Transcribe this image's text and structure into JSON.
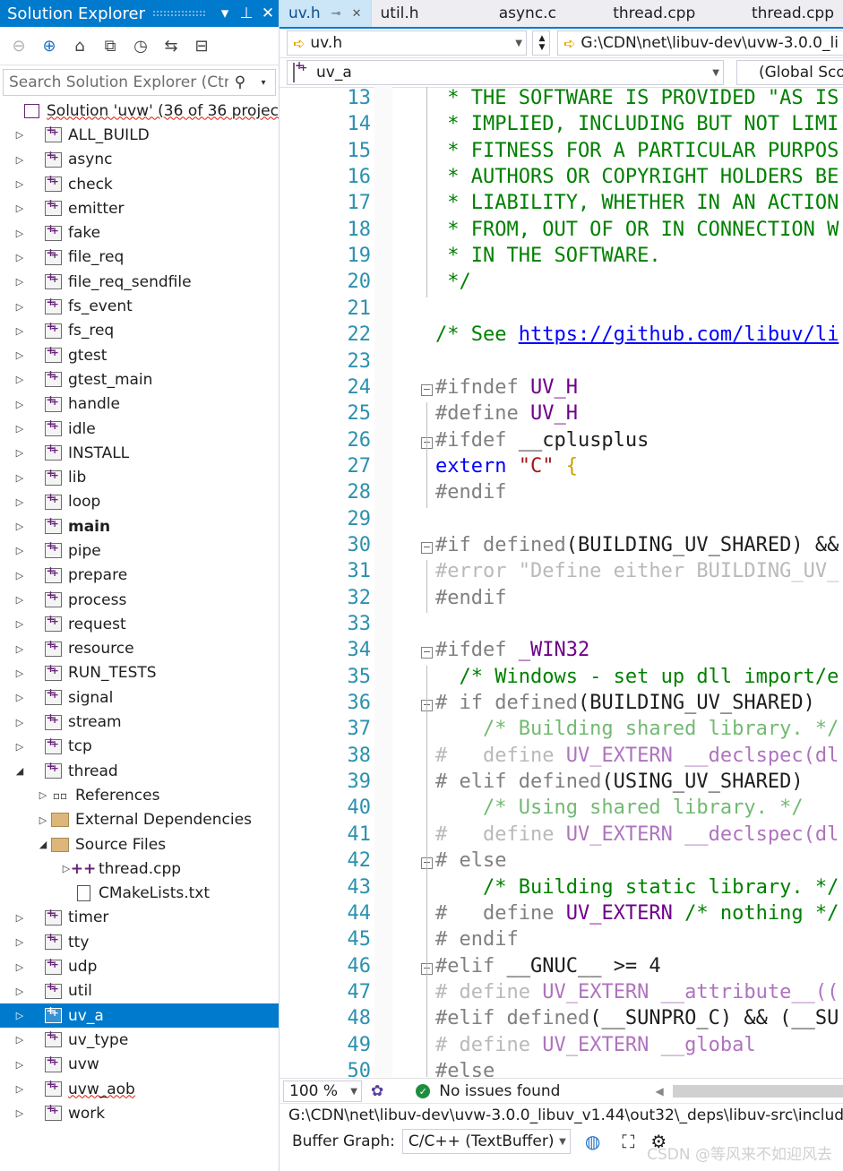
{
  "solution_explorer": {
    "title": "Solution Explorer",
    "search_placeholder": "Search Solution Explorer (Ctrl",
    "solution_label": "Solution 'uvw' (36 of 36 projec",
    "projects": [
      "ALL_BUILD",
      "async",
      "check",
      "emitter",
      "fake",
      "file_req",
      "file_req_sendfile",
      "fs_event",
      "fs_req",
      "gtest",
      "gtest_main",
      "handle",
      "idle",
      "INSTALL",
      "lib",
      "loop",
      "main",
      "pipe",
      "prepare",
      "process",
      "request",
      "resource",
      "RUN_TESTS",
      "signal",
      "stream",
      "tcp",
      "thread"
    ],
    "thread_children": {
      "references": "References",
      "external_dependencies": "External Dependencies",
      "source_files": "Source Files",
      "thread_cpp": "thread.cpp",
      "cmakelists": "CMakeLists.txt"
    },
    "projects_after": [
      "timer",
      "tty",
      "udp",
      "util",
      "uv_a",
      "uv_type",
      "uvw",
      "uvw_aob",
      "work"
    ],
    "selected": "uv_a",
    "bold": "main"
  },
  "editor": {
    "tabs": [
      "uv.h",
      "util.h",
      "async.c",
      "thread.cpp",
      "thread.cpp"
    ],
    "active_tab": "uv.h",
    "file_combo": "uv.h",
    "path_combo": "G:\\CDN\\net\\libuv-dev\\uvw-3.0.0_li",
    "project_combo": "uv_a",
    "scope_combo": "(Global Sco",
    "lines": [
      13,
      14,
      15,
      16,
      17,
      18,
      19,
      20,
      21,
      22,
      23,
      24,
      25,
      26,
      27,
      28,
      29,
      30,
      31,
      32,
      33,
      34,
      35,
      36,
      37,
      38,
      39,
      40,
      41,
      42,
      43,
      44,
      45,
      46,
      47,
      48,
      49,
      50
    ]
  },
  "code": {
    "l13": " * THE SOFTWARE IS PROVIDED \"AS IS",
    "l14": " * IMPLIED, INCLUDING BUT NOT LIMI",
    "l15": " * FITNESS FOR A PARTICULAR PURPOS",
    "l16": " * AUTHORS OR COPYRIGHT HOLDERS BE",
    "l17": " * LIABILITY, WHETHER IN AN ACTION",
    "l18": " * FROM, OUT OF OR IN CONNECTION W",
    "l19": " * IN THE SOFTWARE.",
    "l20": " */",
    "l22a": "/* See ",
    "l22b": "https://github.com/libuv/li",
    "l24a": "#ifndef ",
    "l24b": "UV_H",
    "l25a": "#define ",
    "l25b": "UV_H",
    "l26a": "#ifdef ",
    "l26b": "__cplusplus",
    "l27a": "extern ",
    "l27b": "\"C\" ",
    "l27c": "{",
    "l28": "#endif",
    "l30a": "#if defined",
    "l30b": "(BUILDING_UV_SHARED) &&",
    "l31": "#error \"Define either BUILDING_UV_",
    "l32": "#endif",
    "l34a": "#ifdef ",
    "l34b": "_WIN32",
    "l35": "  /* Windows - set up dll import/e",
    "l36a": "# if defined",
    "l36b": "(BUILDING_UV_SHARED)",
    "l37": "    /* Building shared library. */",
    "l38a": "#   define ",
    "l38b": "UV_EXTERN __declspec(dl",
    "l39a": "# elif defined",
    "l39b": "(USING_UV_SHARED)",
    "l40": "    /* Using shared library. */",
    "l41a": "#   define ",
    "l41b": "UV_EXTERN __declspec(dl",
    "l42": "# else",
    "l43": "    /* Building static library. */",
    "l44a": "#   define ",
    "l44b": "UV_EXTERN ",
    "l44c": "/* nothing */",
    "l45": "# endif",
    "l46a": "#elif ",
    "l46b": "__GNUC__ >= 4",
    "l47a": "# define ",
    "l47b": "UV_EXTERN __attribute__((",
    "l48a": "#elif defined",
    "l48b": "(__SUNPRO_C) && (__SU",
    "l49a": "# define ",
    "l49b": "UV_EXTERN __global",
    "l50": "#else"
  },
  "status": {
    "zoom": "100 %",
    "issues": "No issues found",
    "path": "G:\\CDN\\net\\libuv-dev\\uvw-3.0.0_libuv_v1.44\\out32\\_deps\\libuv-src\\includ",
    "buffer_label": "Buffer Graph:",
    "buffer_value": "C/C++ (TextBuffer)",
    "watermark": "CSDN @等风来不如迎风去"
  }
}
